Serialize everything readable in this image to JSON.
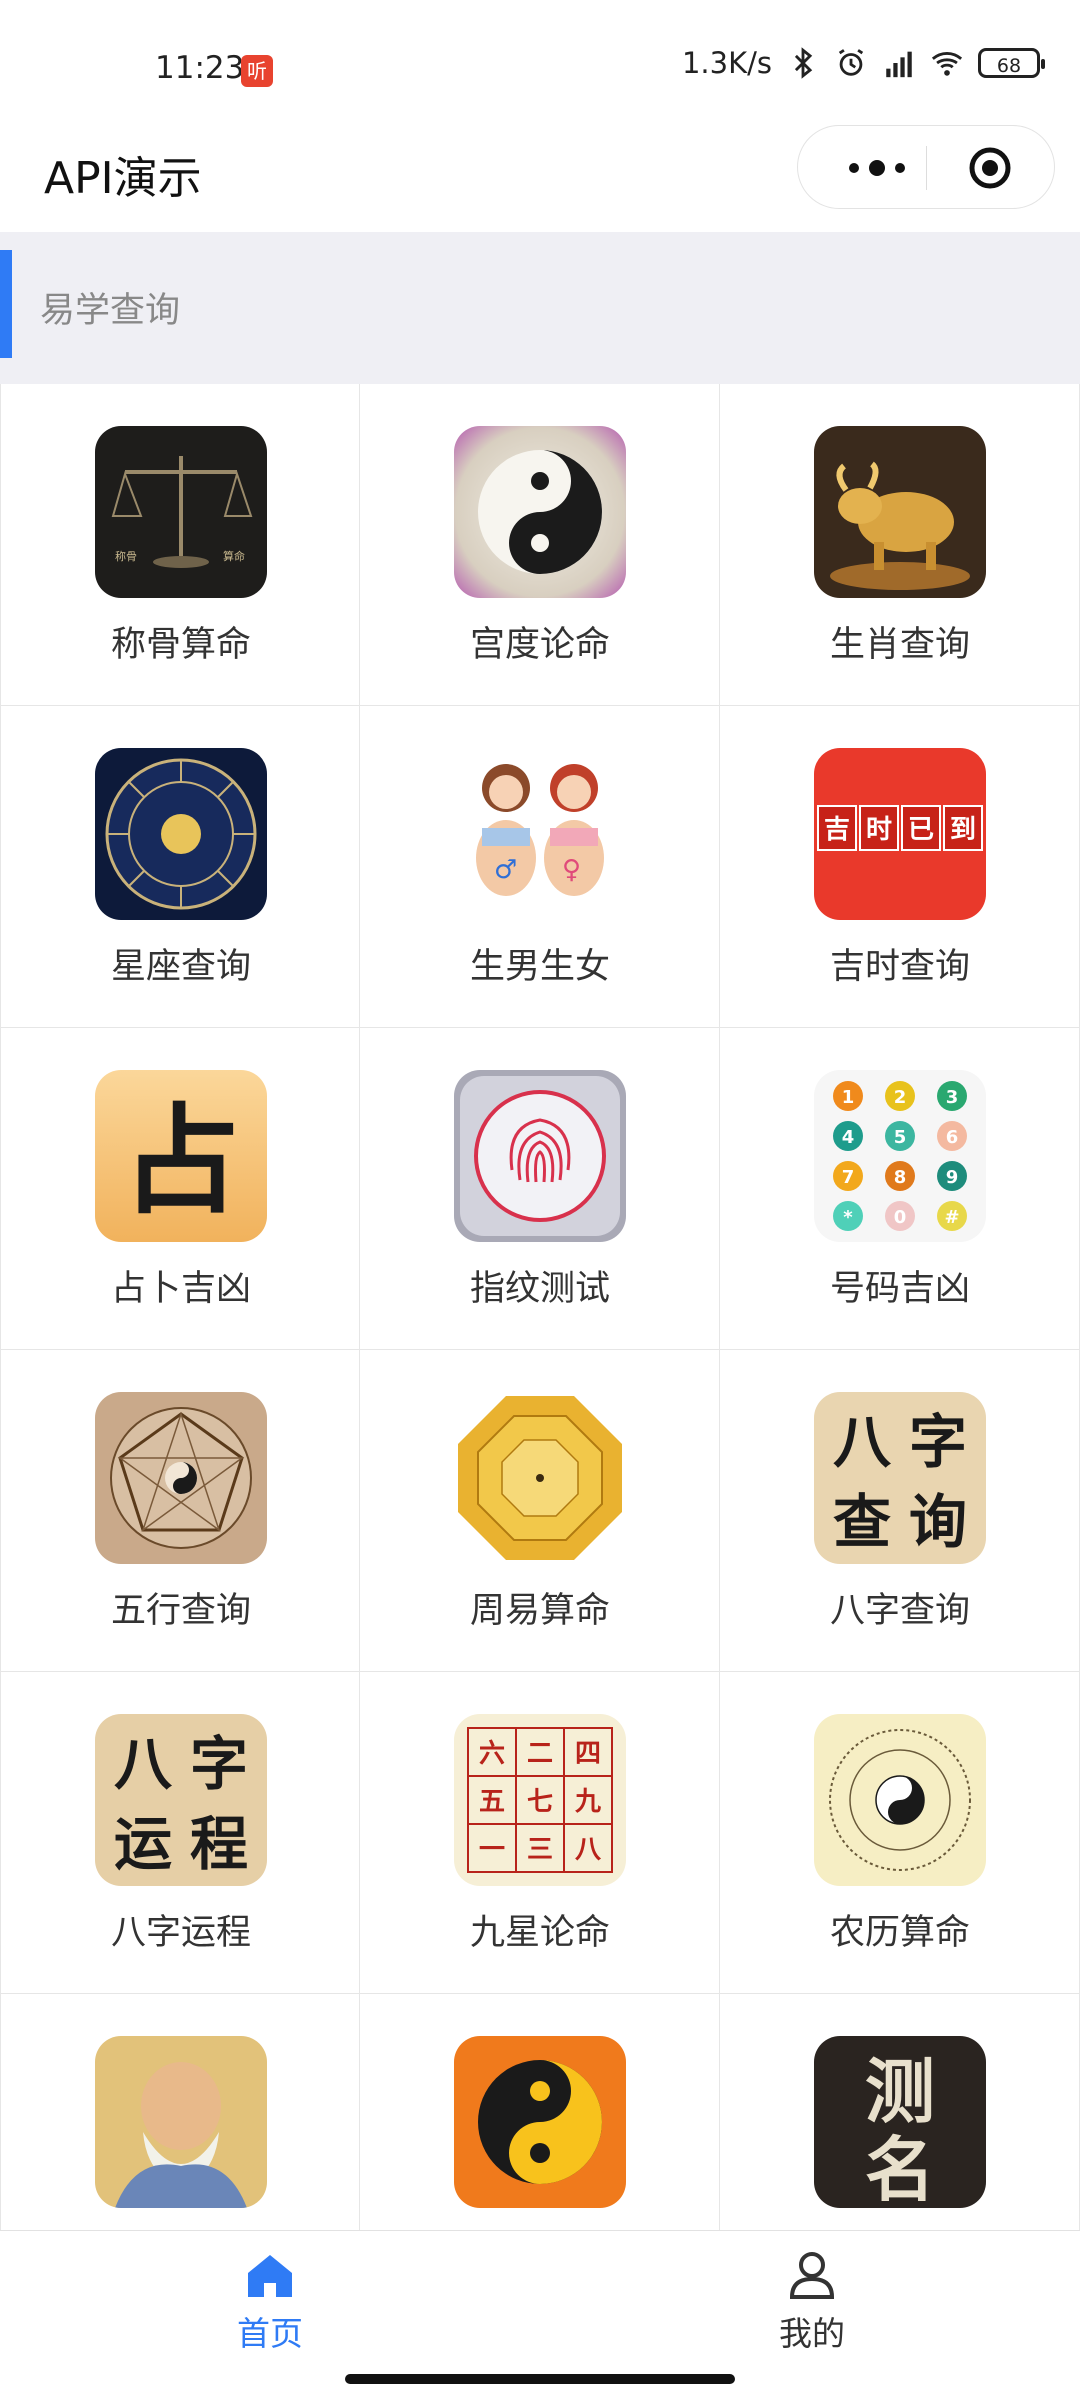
{
  "status_bar": {
    "time": "11:23",
    "notif_badge": "听",
    "net_speed": "1.3K/s",
    "battery": "68",
    "icons": [
      "bluetooth-icon",
      "alarm-icon",
      "signal-icon",
      "wifi-icon",
      "battery-icon"
    ]
  },
  "navbar": {
    "title": "API演示",
    "icons": [
      "more-icon",
      "target-icon"
    ]
  },
  "section": {
    "title": "易学查询",
    "accent": "#2f7bf5"
  },
  "grid": {
    "items": [
      {
        "label": "称骨算命",
        "icon": "scale-icon"
      },
      {
        "label": "宫度论命",
        "icon": "yinyang-ink-icon"
      },
      {
        "label": "生肖查询",
        "icon": "golden-ox-icon"
      },
      {
        "label": "星座查询",
        "icon": "zodiac-wheel-icon"
      },
      {
        "label": "生男生女",
        "icon": "pregnant-women-icon"
      },
      {
        "label": "吉时查询",
        "icon": "lucky-time-icon"
      },
      {
        "label": "占卜吉凶",
        "icon": "divination-icon"
      },
      {
        "label": "指纹测试",
        "icon": "fingerprint-icon"
      },
      {
        "label": "号码吉凶",
        "icon": "number-keypad-icon"
      },
      {
        "label": "五行查询",
        "icon": "five-elements-icon"
      },
      {
        "label": "周易算命",
        "icon": "bagua-icon"
      },
      {
        "label": "八字查询",
        "icon": "bazi-query-icon"
      },
      {
        "label": "八字运程",
        "icon": "bazi-fortune-icon"
      },
      {
        "label": "九星论命",
        "icon": "nine-star-icon"
      },
      {
        "label": "农历算命",
        "icon": "lunar-calendar-icon"
      },
      {
        "label": "",
        "icon": "sage-portrait-icon"
      },
      {
        "label": "",
        "icon": "yinyang-orange-icon"
      },
      {
        "label": "",
        "icon": "name-test-icon"
      }
    ],
    "icon_texts": {
      "scale_left": "称骨",
      "scale_right": "算命",
      "lucky": [
        "吉",
        "时",
        "已",
        "到"
      ],
      "divination": "占",
      "keypad": [
        "1",
        "2",
        "3",
        "4",
        "5",
        "6",
        "7",
        "8",
        "9",
        "*",
        "0",
        "#"
      ],
      "bazi_query": [
        "八",
        "字",
        "查",
        "询"
      ],
      "bazi_fortune": [
        "八",
        "字",
        "运",
        "程"
      ],
      "nine_star": [
        "六",
        "二",
        "四",
        "五",
        "七",
        "九",
        "一",
        "三",
        "八"
      ],
      "name_test": [
        "测",
        "名"
      ]
    }
  },
  "tabbar": {
    "tabs": [
      {
        "label": "首页",
        "icon": "home-icon",
        "active": true
      },
      {
        "label": "我的",
        "icon": "user-icon",
        "active": false
      }
    ],
    "active_color": "#2f7bf5"
  }
}
